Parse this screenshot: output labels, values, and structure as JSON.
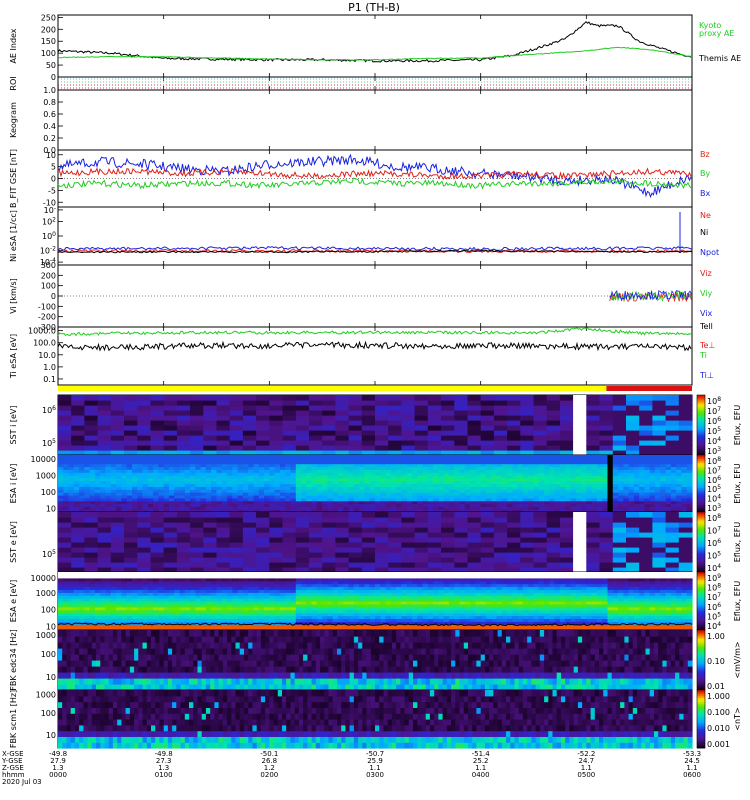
{
  "title": "P1 (TH-B)",
  "date_label": "2020 Jul 03",
  "colors": {
    "red": "#e0201a",
    "green": "#22cc22",
    "blue": "#1a22dd",
    "black": "#000000",
    "yellow": "#ffff00",
    "bar_red": "#dd1111"
  },
  "chart_data": [
    {
      "type": "line",
      "panel": "ae",
      "ylabel": "AE Index",
      "yticks": [
        "0",
        "50",
        "100",
        "150",
        "200",
        "250"
      ],
      "ylim": [
        0,
        260
      ],
      "series": [
        {
          "name": "Themis AE",
          "color": "#000000",
          "x": [
            0,
            0.5,
            1,
            1.5,
            2,
            2.5,
            3,
            3.5,
            4,
            4.3,
            4.6,
            4.8,
            5.0,
            5.1,
            5.3,
            5.5,
            5.7,
            5.9,
            6.0
          ],
          "y": [
            110,
            100,
            78,
            75,
            72,
            72,
            68,
            68,
            72,
            90,
            130,
            160,
            230,
            215,
            215,
            150,
            120,
            95,
            85
          ]
        },
        {
          "name": "Kyoto proxy AE",
          "color": "#22cc22",
          "x": [
            0,
            0.5,
            1,
            1.5,
            2,
            2.5,
            3,
            3.5,
            4,
            4.5,
            5,
            5.3,
            5.6,
            6.0
          ],
          "y": [
            82,
            85,
            85,
            80,
            75,
            72,
            72,
            78,
            80,
            95,
            110,
            125,
            115,
            85
          ]
        }
      ]
    },
    {
      "type": "line",
      "panel": "roi",
      "ylabel": "ROI",
      "yticks": [],
      "ylim": [
        0,
        1
      ]
    },
    {
      "type": "line",
      "panel": "keogram",
      "ylabel": "Keogram",
      "yticks": [
        "0.0",
        "0.2",
        "0.4",
        "0.6",
        "0.8",
        "1.0"
      ],
      "ylim": [
        0,
        1
      ]
    },
    {
      "type": "line",
      "panel": "bfield",
      "ylabel": "B_FIT GSE [nT]",
      "yticks": [
        "10",
        "5",
        "0",
        "-5",
        "-10"
      ],
      "ylim": [
        -12,
        12
      ],
      "series": [
        {
          "name": "Bz",
          "color": "#e0201a",
          "y": [
            2,
            3,
            3,
            2,
            3,
            2,
            1,
            2,
            2,
            1,
            1,
            2,
            1,
            2,
            3,
            2
          ]
        },
        {
          "name": "By",
          "color": "#22cc22",
          "y": [
            -3,
            -2,
            -3,
            -2,
            -2,
            -3,
            -2,
            -1,
            -2,
            -2,
            -3,
            -2,
            -2,
            -1,
            -2,
            -3
          ]
        },
        {
          "name": "Bx",
          "color": "#1a22dd",
          "y": [
            5,
            7,
            6,
            4,
            3,
            6,
            7,
            8,
            5,
            4,
            2,
            1,
            -1,
            0,
            -6,
            1
          ]
        }
      ]
    },
    {
      "type": "line",
      "panel": "density",
      "ylabel": "Ni eSA [1/cc]",
      "yticks": [
        "10^-",
        "10^2",
        "10^0",
        "10^-2",
        "10^-4"
      ],
      "series": [
        {
          "name": "Ne",
          "color": "#e0201a"
        },
        {
          "name": "Ni",
          "color": "#000000"
        },
        {
          "name": "Npot",
          "color": "#1a22dd"
        }
      ]
    },
    {
      "type": "line",
      "panel": "velocity",
      "ylabel": "Vi [km/s]",
      "yticks": [
        "300",
        "200",
        "100",
        "0",
        "-100",
        "-200",
        "-300"
      ],
      "ylim": [
        -300,
        300
      ],
      "series": [
        {
          "name": "Viz",
          "color": "#e0201a"
        },
        {
          "name": "Viy",
          "color": "#22cc22"
        },
        {
          "name": "Vix",
          "color": "#1a22dd"
        }
      ]
    },
    {
      "type": "line",
      "panel": "temperature",
      "ylabel": "Ti eSA [eV]",
      "yticks": [
        "1000.0",
        "100.0",
        "10.0",
        "1.0",
        "0.1"
      ],
      "series": [
        {
          "name": "Tell",
          "color": "#000000",
          "y": [
            45,
            40,
            50,
            60,
            55,
            65,
            60,
            55,
            60,
            50,
            48,
            45,
            40
          ]
        },
        {
          "name": "Te⊥",
          "color": "#e0201a"
        },
        {
          "name": "Ti",
          "color": "#22cc22",
          "y": [
            500,
            600,
            650,
            700,
            680,
            700,
            720,
            700,
            680,
            650,
            1500,
            600,
            550
          ]
        },
        {
          "name": "Ti⊥",
          "color": "#1a22dd"
        }
      ]
    },
    {
      "type": "heatmap",
      "panel": "sst_ion",
      "ylabel": "SST i [eV]",
      "yticks": [
        "10^6",
        "10^5"
      ],
      "colorbar_label": "Eflux, EFU",
      "colorbar_ticks": [
        "10^8",
        "10^7",
        "10^6",
        "10^5",
        "10^4",
        "10^3"
      ]
    },
    {
      "type": "heatmap",
      "panel": "esa_ion",
      "ylabel": "ESA i [eV]",
      "yticks": [
        "10000",
        "1000",
        "100",
        "10"
      ],
      "colorbar_label": "Eflux, EFU",
      "colorbar_ticks": [
        "10^8",
        "10^7",
        "10^6",
        "10^5",
        "10^4",
        "10^3"
      ]
    },
    {
      "type": "heatmap",
      "panel": "sst_elec",
      "ylabel": "SST e [eV]",
      "yticks": [
        "10^5"
      ],
      "colorbar_label": "Eflux, EFU",
      "colorbar_ticks": [
        "10^8",
        "10^7",
        "10^6",
        "10^5",
        "10^4"
      ]
    },
    {
      "type": "heatmap",
      "panel": "esa_elec",
      "ylabel": "ESA e [eV]",
      "yticks": [
        "10000",
        "1000",
        "100",
        "10"
      ],
      "colorbar_label": "Eflux, EFU",
      "colorbar_ticks": [
        "10^9",
        "10^8",
        "10^7",
        "10^6",
        "10^5",
        "10^4"
      ]
    },
    {
      "type": "heatmap",
      "panel": "fbk_e",
      "ylabel": "FBK edc34 [Hz]",
      "yticks": [
        "1000",
        "100",
        "10"
      ],
      "colorbar_label": "<mV/m>",
      "colorbar_ticks": [
        "1.00",
        "0.10",
        "0.01"
      ]
    },
    {
      "type": "heatmap",
      "panel": "fbk_b",
      "ylabel": "FBK scm1 [Hz]",
      "yticks": [
        "1000",
        "100",
        "10"
      ],
      "colorbar_label": "<nT>",
      "colorbar_ticks": [
        "1.000",
        "0.100",
        "0.010",
        "0.001"
      ]
    }
  ],
  "axis_rows": {
    "labels": [
      "X-GSE",
      "Y-GSE",
      "Z-GSE",
      "hhmm"
    ],
    "columns": [
      {
        "x_gse": "-49.8",
        "y_gse": "27.9",
        "z_gse": "1.3",
        "hhmm": "0000"
      },
      {
        "x_gse": "-49.8",
        "y_gse": "27.3",
        "z_gse": "1.3",
        "hhmm": "0100"
      },
      {
        "x_gse": "-50.1",
        "y_gse": "26.8",
        "z_gse": "1.2",
        "hhmm": "0200"
      },
      {
        "x_gse": "-50.7",
        "y_gse": "25.9",
        "z_gse": "1.1",
        "hhmm": "0300"
      },
      {
        "x_gse": "-51.4",
        "y_gse": "25.2",
        "z_gse": "1.1",
        "hhmm": "0400"
      },
      {
        "x_gse": "-52.2",
        "y_gse": "24.7",
        "z_gse": "1.1",
        "hhmm": "0500"
      },
      {
        "x_gse": "-53.3",
        "y_gse": "24.5",
        "z_gse": "1.1",
        "hhmm": "0600"
      }
    ]
  }
}
